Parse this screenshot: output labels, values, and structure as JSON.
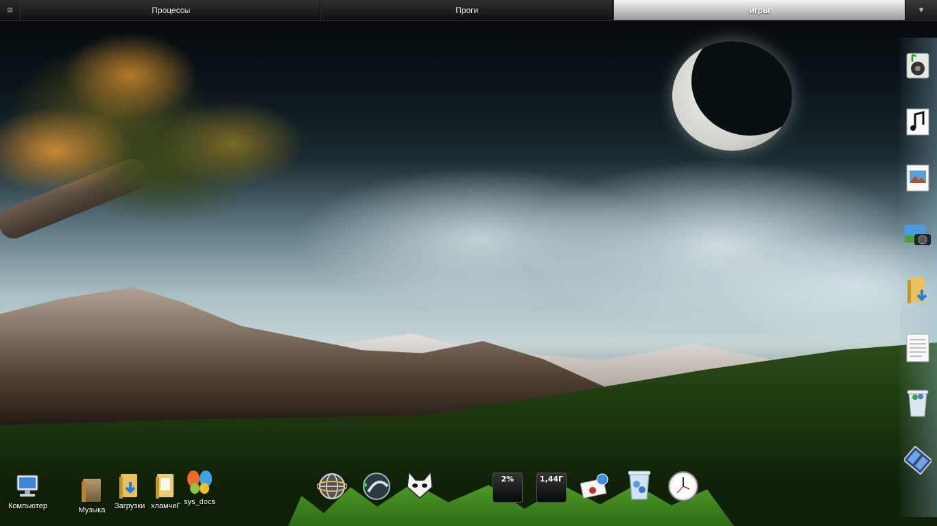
{
  "top_tabs": [
    {
      "label": "Процессы",
      "active": false
    },
    {
      "label": "Проги",
      "active": false
    },
    {
      "label": "игры",
      "active": true
    }
  ],
  "desktop_icons": [
    {
      "name": "computer-icon",
      "label": "Компьютер"
    },
    {
      "name": "music-folder-icon",
      "label": "Музыка"
    },
    {
      "name": "downloads-folder-icon",
      "label": "Загрузки"
    },
    {
      "name": "folder-icon",
      "label": "хламчеГ"
    },
    {
      "name": "msn-butterfly-icon",
      "label": "sys_docs"
    }
  ],
  "dock": {
    "cpu_meter": "2%",
    "memory_meter": "1,44Г"
  },
  "right_dock_items": [
    "speaker-music-icon",
    "music-note-icon",
    "image-viewer-icon",
    "camera-icon",
    "downloads-folder-icon",
    "text-document-icon",
    "recycle-bin-icon",
    "film-strip-icon"
  ],
  "colors": {
    "sky_dark": "#0a1418",
    "grass": "#1f3d10",
    "active_tab": "#f5f5f5"
  }
}
